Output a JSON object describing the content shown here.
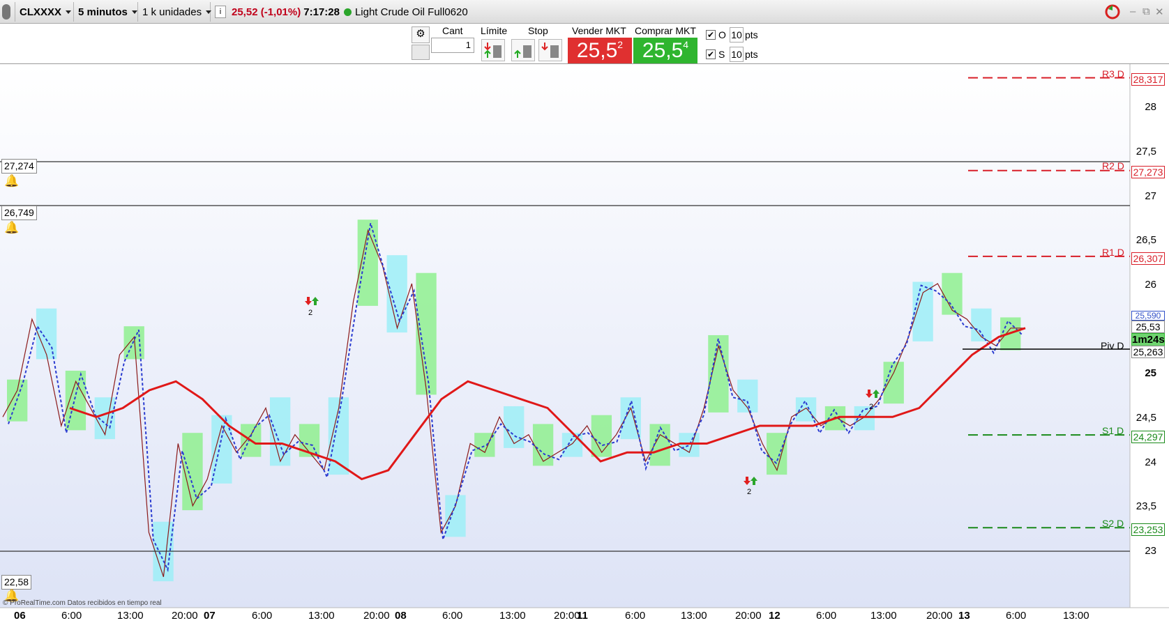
{
  "toolbar": {
    "symbol": "CLXXXX",
    "timeframe": "5 minutos",
    "units": "1 k unidades",
    "price_change": "25,52 (-1,01%)",
    "time": "7:17:28",
    "instrument": "Light Crude Oil Full0620",
    "info_icon": "info-icon",
    "refresh_icon": "refresh-icon",
    "minimize": "–",
    "restore": "⧉",
    "close": "✕"
  },
  "order": {
    "cant_label": "Cant",
    "cant_value": "1",
    "limite_label": "Límite",
    "stop_label": "Stop",
    "sell_label": "Vender MKT",
    "buy_label": "Comprar MKT",
    "sell_price": "25,5",
    "sell_sup": "2",
    "buy_price": "25,5",
    "buy_sup": "4",
    "o_label": "O",
    "s_label": "S",
    "o_pts": "10",
    "s_pts": "10",
    "pts_label": "pts",
    "sell_color": "#e03030",
    "buy_color": "#2fb52f"
  },
  "chart": {
    "hlines": [
      {
        "label": "27,274"
      },
      {
        "label": "26,749"
      },
      {
        "label": "22,58"
      }
    ],
    "countdown": "1m24s",
    "last_price": "25,53",
    "hidden_price": "25,590",
    "watermark": "© ProRealTime.com  Datos recibidos en tiempo real",
    "y_ticks": [
      "28",
      "27,5",
      "27",
      "26,5",
      "26",
      "25",
      "24,5",
      "24",
      "23,5",
      "23"
    ],
    "levels": [
      {
        "name": "R3 D",
        "value": "28,317",
        "color": "#d81e28"
      },
      {
        "name": "R2 D",
        "value": "27,273",
        "color": "#d81e28"
      },
      {
        "name": "R1 D",
        "value": "26,307",
        "color": "#d81e28"
      },
      {
        "name": "Piv D",
        "value": "25,263",
        "color": "#000000"
      },
      {
        "name": "S1 D",
        "value": "24,297",
        "color": "#1a8a1a"
      },
      {
        "name": "S2 D",
        "value": "23,253",
        "color": "#1a8a1a"
      }
    ],
    "x_labels": [
      {
        "t": "06",
        "day": true
      },
      {
        "t": "6:00"
      },
      {
        "t": "13:00"
      },
      {
        "t": "20:00"
      },
      {
        "t": "07",
        "day": true
      },
      {
        "t": "6:00"
      },
      {
        "t": "13:00"
      },
      {
        "t": "20:00"
      },
      {
        "t": "08",
        "day": true
      },
      {
        "t": "6:00"
      },
      {
        "t": "13:00"
      },
      {
        "t": "20:00"
      },
      {
        "t": "11",
        "day": true
      },
      {
        "t": "6:00"
      },
      {
        "t": "13:00"
      },
      {
        "t": "20:00"
      },
      {
        "t": "12",
        "day": true
      },
      {
        "t": "6:00"
      },
      {
        "t": "13:00"
      },
      {
        "t": "20:00"
      },
      {
        "t": "13",
        "day": true
      },
      {
        "t": "6:00"
      },
      {
        "t": "13:00"
      }
    ],
    "signals": [
      {
        "label": "2"
      },
      {
        "label": "2"
      },
      {
        "label": "2"
      }
    ]
  },
  "chart_data": {
    "type": "line",
    "series": [
      {
        "name": "",
        "values": [
          24.5,
          24.8,
          25.6,
          25.2,
          24.4,
          24.9,
          24.6,
          24.3,
          25.2,
          25.4,
          23.2,
          22.7,
          24.2,
          23.5,
          23.8,
          24.4,
          24.1,
          24.3,
          24.6,
          24.0,
          24.3,
          24.1,
          23.9,
          24.6,
          25.8,
          26.6,
          26.2,
          25.5,
          26.0,
          24.8,
          23.2,
          23.5,
          24.2,
          24.1,
          24.5,
          24.2,
          24.3,
          24.0,
          24.1,
          24.2,
          24.4,
          24.1,
          24.3,
          24.6,
          24.0,
          24.3,
          24.2,
          24.1,
          24.6,
          25.3,
          24.8,
          24.6,
          24.2,
          23.9,
          24.5,
          24.6,
          24.4,
          24.5,
          24.4,
          24.5,
          24.7,
          25.0,
          25.4,
          25.9,
          26.0,
          25.7,
          25.6,
          25.4,
          25.3,
          25.5,
          25.5
        ]
      },
      {
        "name": "",
        "values": [
          24.6,
          24.5,
          24.6,
          24.8,
          24.9,
          24.7,
          24.4,
          24.2,
          24.2,
          24.1,
          24.0,
          23.8,
          23.9,
          24.3,
          24.7,
          24.9,
          24.8,
          24.7,
          24.6,
          24.3,
          24.0,
          24.1,
          24.1,
          24.2,
          24.2,
          24.3,
          24.4,
          24.4,
          24.4,
          24.5,
          24.5,
          24.5,
          24.6,
          24.9,
          25.2,
          25.4,
          25.5
        ]
      }
    ],
    "ylim": [
      22.5,
      28.5
    ]
  }
}
